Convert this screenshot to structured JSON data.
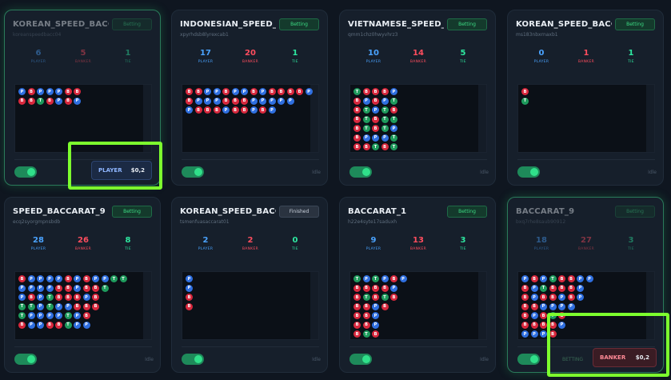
{
  "labels": {
    "player": "PLAYER",
    "banker": "BANKER",
    "tie": "TIE"
  },
  "colors": {
    "player": "#2f6fe0",
    "banker": "#d8283d",
    "tie": "#1e9b5c",
    "accent": "#3ddc84",
    "highlight": "#7dff2e"
  },
  "tables": [
    {
      "title": "KOREAN_SPEED_BACCARAT",
      "subtitle": "koreanspeedbacc04",
      "status": "Betting",
      "player": "6",
      "banker": "5",
      "tie": "1",
      "state_text": "",
      "bet_label": "PLAYER",
      "bet_amount": "$0,2",
      "road": [
        "PB",
        "BB",
        "PT",
        "PB",
        "PP",
        "BB",
        "BP"
      ]
    },
    {
      "title": "INDONESIAN_SPEED_BACCARAT",
      "subtitle": "xpyrhdsb8lyrexcab1",
      "status": "Betting",
      "player": "17",
      "banker": "20",
      "tie": "1",
      "state_text": "Idle",
      "bet_label": "",
      "bet_amount": "",
      "road": [
        "BBP",
        "BPB",
        "PPB",
        "PPB",
        "BBP",
        "PBB",
        "PBB",
        "BPP",
        "PPB",
        "BPP",
        "BP",
        "BP",
        "B",
        "P"
      ]
    },
    {
      "title": "VIETNAMESE_SPEED_BACCARAT",
      "subtitle": "qmm1chz0hwyvhrz3",
      "status": "Betting",
      "player": "10",
      "banker": "14",
      "tie": "5",
      "state_text": "Idle",
      "bet_label": "",
      "bet_amount": "",
      "road": [
        "TBBBBBB",
        "BPTTTPB",
        "BBPBBPT",
        "BPTTTPB",
        "PTBTPTT"
      ]
    },
    {
      "title": "KOREAN_SPEED_BACCARAT",
      "subtitle": "ms183nbxrnaxb1",
      "status": "Betting",
      "player": "0",
      "banker": "1",
      "tie": "1",
      "state_text": "Idle",
      "bet_label": "",
      "bet_amount": "",
      "road": [
        "BT"
      ]
    },
    {
      "title": "SPEED_BACCARAT_9",
      "subtitle": "ecq2syorgmpnsbdb",
      "status": "Betting",
      "player": "28",
      "banker": "26",
      "tie": "8",
      "state_text": "Idle",
      "bet_label": "",
      "bet_amount": "",
      "road": [
        "BPPTTB",
        "PPBTPP",
        "PPPPPP",
        "PPTTPB",
        "PBBPPB",
        "BBBPTT",
        "PPBBPP",
        "BBPBBP",
        "PBBB",
        "PT",
        "T",
        "T"
      ]
    },
    {
      "title": "KOREAN_SPEED_BACCARAT",
      "subtitle": "tsmenfuasaccarat01",
      "status": "Finished",
      "player": "2",
      "banker": "2",
      "tie": "0",
      "state_text": "Idle",
      "bet_label": "",
      "bet_amount": "",
      "road": [
        "PPBB"
      ]
    },
    {
      "title": "BACCARAT_1",
      "subtitle": "h22e4syte17saduxh",
      "status": "Betting",
      "player": "9",
      "banker": "13",
      "tie": "3",
      "state_text": "Idle",
      "bet_label": "",
      "bet_amount": "",
      "road": [
        "TBBBBBB",
        "PBTBBBT",
        "TBBPPPB",
        "PBTB",
        "BPB",
        "P"
      ]
    },
    {
      "title": "BACCARAT_9",
      "subtitle": "bxq7rhe8saub90912",
      "status": "Betting",
      "player": "18",
      "banker": "27",
      "tie": "3",
      "state_text": "BETTING",
      "bet_label": "BANKER",
      "bet_amount": "$0,2",
      "road": [
        "PBBBBBP",
        "BPPBPBP",
        "PTBPBBP",
        "TBBPTBB",
        "BBPPBP",
        "BBBP",
        "PPP",
        "P"
      ]
    }
  ]
}
